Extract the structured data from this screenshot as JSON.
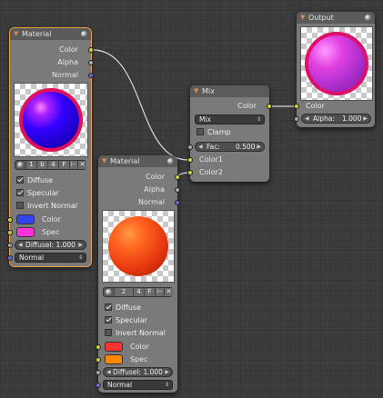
{
  "nodes": {
    "material_1": {
      "title": "Material",
      "outputs": [
        "Color",
        "Alpha",
        "Normal"
      ],
      "material_selector": {
        "name": "1",
        "letter": "b",
        "users": "4",
        "fake": "F"
      },
      "checkboxes": [
        {
          "label": "Diffuse",
          "checked": true
        },
        {
          "label": "Specular",
          "checked": true
        },
        {
          "label": "Invert Normal",
          "checked": false
        }
      ],
      "color_label": "Color",
      "color_value": "#3344ee",
      "spec_label": "Spec",
      "spec_value": "#ff33dd",
      "diffuse_field": "DiffuseI: 1.000",
      "normal_dropdown": "Normal",
      "ball_color": "#3300ff",
      "rim_color": "#e0105a"
    },
    "material_2": {
      "title": "Material",
      "outputs": [
        "Color",
        "Alpha",
        "Normal"
      ],
      "material_selector": {
        "name": "2",
        "users": "4",
        "fake": "F"
      },
      "checkboxes": [
        {
          "label": "Diffuse",
          "checked": true
        },
        {
          "label": "Specular",
          "checked": true
        },
        {
          "label": "Invert Normal",
          "checked": false
        }
      ],
      "color_label": "Color",
      "color_value": "#ff3333",
      "spec_label": "Spec",
      "spec_value": "#ff8800",
      "diffuse_field": "DiffuseI: 1.000",
      "normal_dropdown": "Normal",
      "ball_color": "#ff5522"
    },
    "mix": {
      "title": "Mix",
      "output": "Color",
      "blend_mode": "Mix",
      "clamp_label": "Clamp",
      "clamp_checked": false,
      "fac_field": "Fac:",
      "fac_value": "0.500",
      "inputs": [
        "Color1",
        "Color2"
      ]
    },
    "output": {
      "title": "Output",
      "input": "Color",
      "alpha_field": "Alpha:",
      "alpha_value": "1.000",
      "ball_color": "#cc44cc",
      "rim_color": "#e0106a"
    }
  },
  "colors": {
    "socket_color": "#cfcf30",
    "socket_value": "#a6a6a6",
    "socket_vector": "#6868d0",
    "active_outline": "#f0a040"
  }
}
